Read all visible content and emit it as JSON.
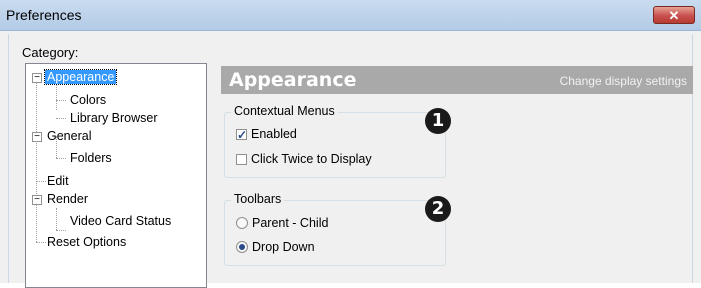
{
  "window": {
    "title": "Preferences",
    "close_glyph": "✕"
  },
  "category_label": "Category:",
  "tree": {
    "items": [
      {
        "label": "Appearance",
        "expander": "−",
        "selected": true
      },
      {
        "label": "Colors"
      },
      {
        "label": "Library Browser"
      },
      {
        "label": "General",
        "expander": "−"
      },
      {
        "label": "Folders"
      },
      {
        "label": "Edit"
      },
      {
        "label": "Render",
        "expander": "−"
      },
      {
        "label": "Video Card Status"
      },
      {
        "label": "Reset Options"
      }
    ]
  },
  "panel": {
    "title": "Appearance",
    "subtitle": "Change display settings"
  },
  "contextual_menus": {
    "legend": "Contextual Menus",
    "enabled_label": "Enabled",
    "enabled_checked": true,
    "click_twice_label": "Click Twice to Display",
    "click_twice_checked": false,
    "callout": "1"
  },
  "toolbars": {
    "legend": "Toolbars",
    "parent_child_label": "Parent - Child",
    "drop_down_label": "Drop Down",
    "selected": "Drop Down",
    "callout": "2"
  },
  "colors": {
    "selection": "#3399ff",
    "panel_header": "#a9a9a9",
    "close_button": "#c75050"
  }
}
